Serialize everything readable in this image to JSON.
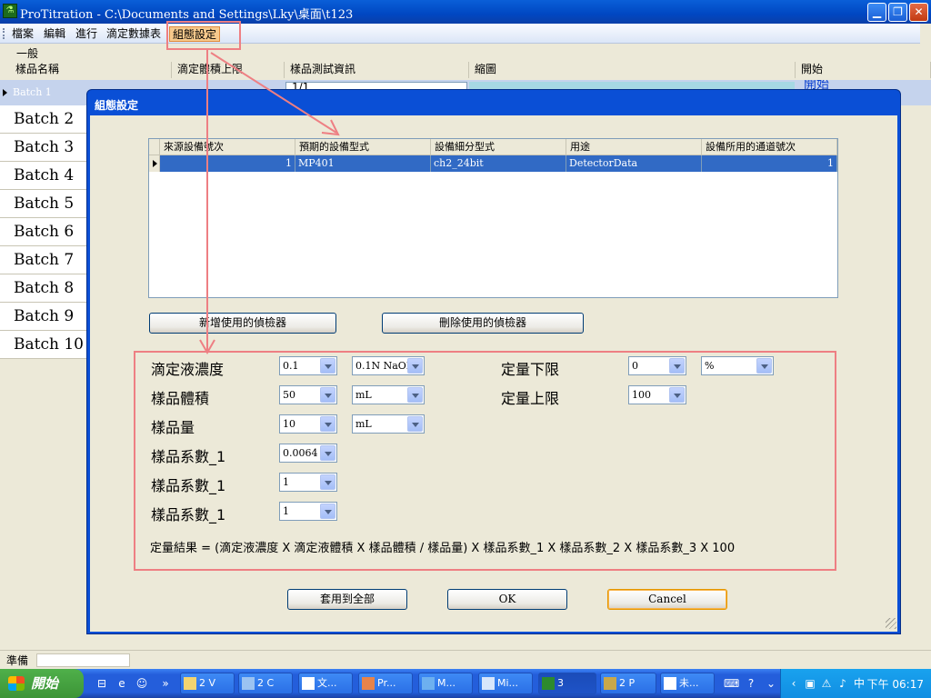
{
  "window": {
    "title": "ProTitration - C:\\Documents and Settings\\Lky\\桌面\\t123"
  },
  "menu": [
    "檔案",
    "編輯",
    "進行",
    "滴定數據表",
    "組態設定"
  ],
  "group_label": "一般",
  "main_grid": {
    "headers": [
      "樣品名稱",
      "滴定體積上限",
      "樣品測試資訊",
      "縮圖",
      "開始"
    ],
    "batch1": {
      "name": "Batch 1",
      "info": "1/1",
      "start": "開始"
    },
    "rows": [
      "Batch 2",
      "Batch 3",
      "Batch 4",
      "Batch 5",
      "Batch 6",
      "Batch 7",
      "Batch 8",
      "Batch 9",
      "Batch 10"
    ]
  },
  "dialog": {
    "title": "組態設定",
    "grid": {
      "headers": [
        "來源設備號次",
        "預期的設備型式",
        "設備細分型式",
        "用途",
        "設備所用的通道號次"
      ],
      "row": [
        "1",
        "MP401",
        "ch2_24bit",
        "DetectorData",
        "1"
      ]
    },
    "add_button": "新增使用的偵檢器",
    "remove_button": "刪除使用的偵檢器",
    "fields": [
      {
        "label": "滴定液濃度",
        "value": "0.1",
        "unit": "0.1N NaOH"
      },
      {
        "label": "樣品體積",
        "value": "50",
        "unit": "mL"
      },
      {
        "label": "樣品量",
        "value": "10",
        "unit": "mL"
      },
      {
        "label": "樣品系數_1",
        "value": "0.0064"
      },
      {
        "label": "樣品系數_1",
        "value": "1"
      },
      {
        "label": "樣品系數_1",
        "value": "1"
      }
    ],
    "limits": [
      {
        "label": "定量下限",
        "value": "0",
        "unit": "%"
      },
      {
        "label": "定量上限",
        "value": "100"
      }
    ],
    "formula": "定量結果 = (滴定液濃度 X 滴定液體積 X 樣品體積 / 樣品量) X 樣品系數_1 X 樣品系數_2 X 樣品系數_3 X 100",
    "apply_all_button": "套用到全部",
    "ok_button": "OK",
    "cancel_button": "Cancel"
  },
  "status": {
    "text": "準備"
  },
  "taskbar": {
    "start": "開始",
    "tasks": [
      "2 V",
      "2 C",
      "文...",
      "Pr...",
      "M...",
      "Mi...",
      "3",
      "2 P",
      "未..."
    ],
    "clock": "下午 06:17"
  },
  "colors": {
    "annotation": "#ee7f83",
    "selection": "#316ac5",
    "title_blue": "#0a4fd6"
  }
}
